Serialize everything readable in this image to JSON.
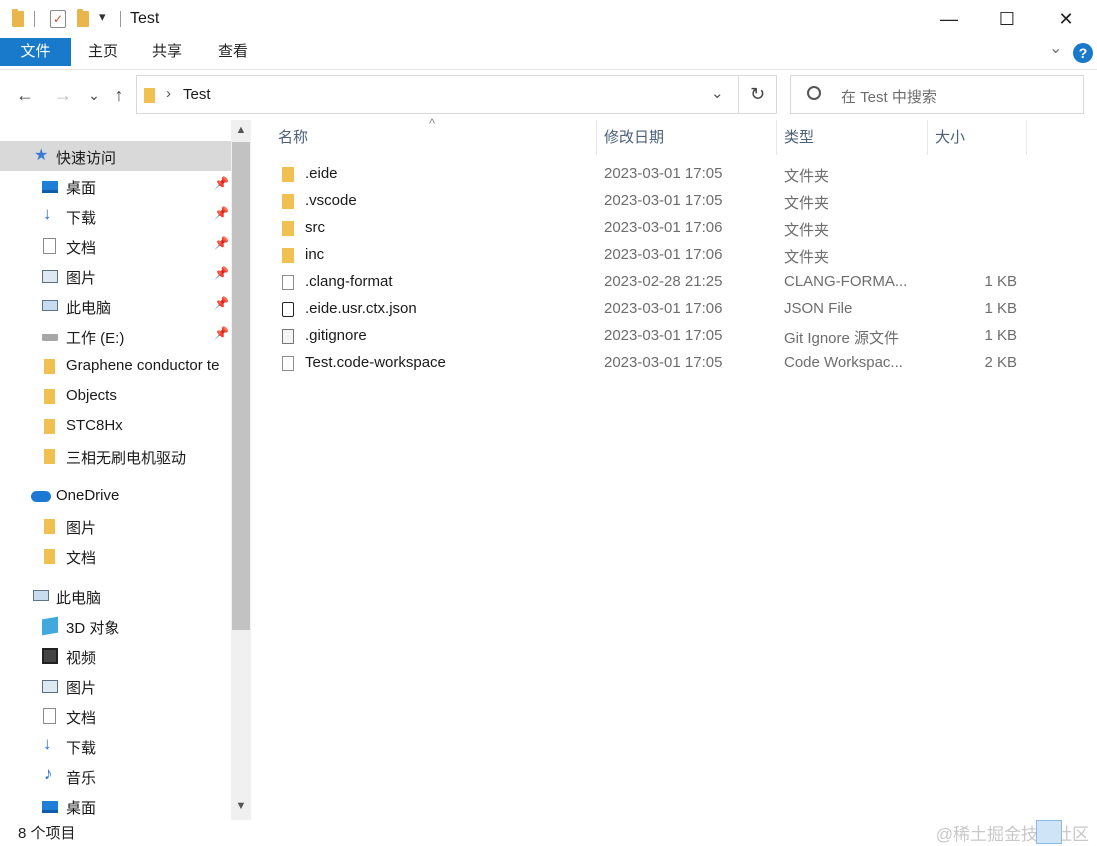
{
  "window": {
    "title": "Test",
    "qat_dropdown": "▾",
    "controls": {
      "minimize": "—",
      "maximize": "☐",
      "close": "✕"
    }
  },
  "ribbon": {
    "tabs": [
      "文件",
      "主页",
      "共享",
      "查看"
    ],
    "collapse": "⌄",
    "help": "?"
  },
  "nav": {
    "back": "←",
    "forward": "→",
    "recent": "⌄",
    "up": "↑",
    "breadcrumb_sep": "›",
    "location": "Test",
    "address_dropdown": "⌄",
    "refresh": "↻",
    "search_placeholder": "在 Test 中搜索"
  },
  "sidebar": {
    "quick_access": "快速访问",
    "quick_items": [
      "桌面",
      "下载",
      "文档",
      "图片",
      "此电脑",
      "工作 (E:)",
      "Graphene conductor te",
      "Objects",
      "STC8Hx",
      "三相无刷电机驱动"
    ],
    "onedrive": "OneDrive",
    "onedrive_items": [
      "图片",
      "文档"
    ],
    "this_pc": "此电脑",
    "pc_items": [
      "3D 对象",
      "视频",
      "图片",
      "文档",
      "下载",
      "音乐",
      "桌面"
    ],
    "pin_glyph": "📌",
    "scroll_up": "▲",
    "scroll_down": "▼"
  },
  "columns": {
    "name": "名称",
    "date": "修改日期",
    "type": "类型",
    "size": "大小",
    "sort_indicator": "^"
  },
  "files": [
    {
      "name": ".eide",
      "date": "2023-03-01 17:05",
      "type": "文件夹",
      "size": "",
      "icon": "folder-icon"
    },
    {
      "name": ".vscode",
      "date": "2023-03-01 17:05",
      "type": "文件夹",
      "size": "",
      "icon": "folder-icon"
    },
    {
      "name": "src",
      "date": "2023-03-01 17:06",
      "type": "文件夹",
      "size": "",
      "icon": "folder-icon"
    },
    {
      "name": "inc",
      "date": "2023-03-01 17:06",
      "type": "文件夹",
      "size": "",
      "icon": "folder-icon"
    },
    {
      "name": ".clang-format",
      "date": "2023-02-28 21:25",
      "type": "CLANG-FORMA...",
      "size": "1 KB",
      "icon": "file-icon"
    },
    {
      "name": ".eide.usr.ctx.json",
      "date": "2023-03-01 17:06",
      "type": "JSON File",
      "size": "1 KB",
      "icon": "json-icon"
    },
    {
      "name": ".gitignore",
      "date": "2023-03-01 17:05",
      "type": "Git Ignore 源文件",
      "size": "1 KB",
      "icon": "gitignore-icon"
    },
    {
      "name": "Test.code-workspace",
      "date": "2023-03-01 17:05",
      "type": "Code Workspac...",
      "size": "2 KB",
      "icon": "file-icon"
    }
  ],
  "status": {
    "count": "8 个项目",
    "watermark": "@稀土掘金技术社区"
  },
  "colors": {
    "accent": "#1979ca",
    "folder": "#f0c050",
    "selected": "#d9d9d9"
  }
}
